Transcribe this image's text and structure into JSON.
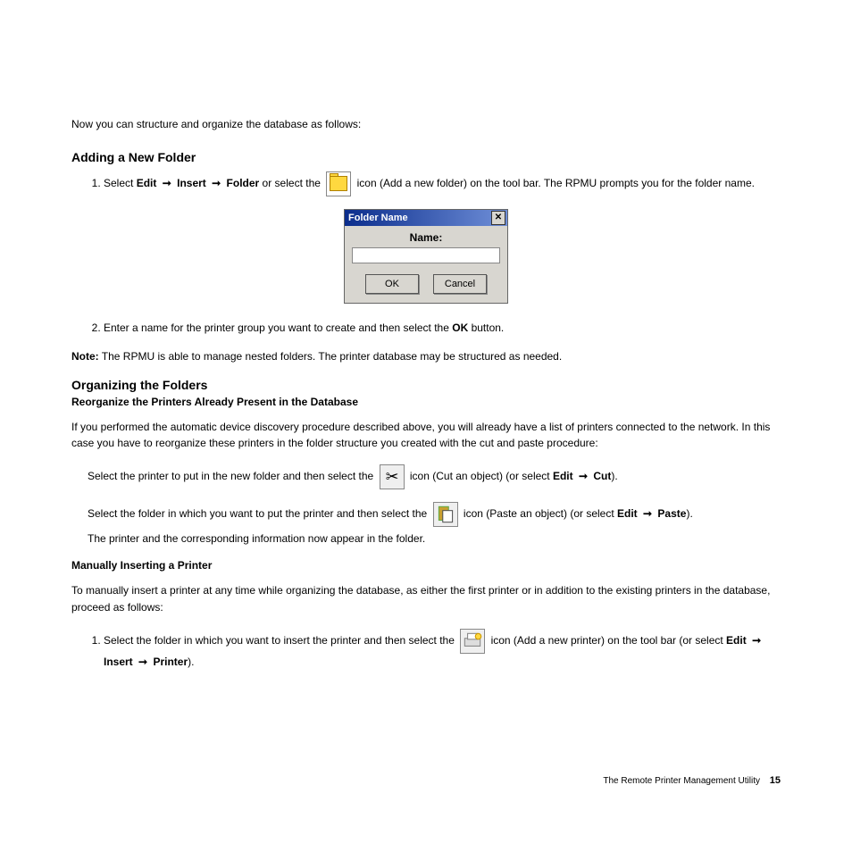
{
  "intro": "Now you can structure and organize the database as follows:",
  "section_add_folder": {
    "heading": "Adding a New Folder",
    "step1_a": "Select ",
    "step1_edit": "Edit",
    "step1_insert": "Insert",
    "step1_folder": "Folder",
    "step1_b": " or select the ",
    "step1_c": " icon (Add a new folder) on the tool bar. The RPMU prompts you for the folder name.",
    "step2_a": "Enter a name for the printer group you want to create and then select the ",
    "step2_ok": "OK",
    "step2_b": " button.",
    "note_label": "Note:",
    "note_text": "  The RPMU is able to manage nested folders. The printer database may be structured as needed."
  },
  "dialog": {
    "title": "Folder Name",
    "close": "✕",
    "label": "Name:",
    "value": "",
    "ok": "OK",
    "cancel": "Cancel"
  },
  "section_organize": {
    "heading": "Organizing the Folders",
    "sub": "Reorganize the Printers Already Present in the Database",
    "p1": "If you performed the automatic device discovery procedure described above, you will already have a list of printers connected to the network. In this case you have to reorganize these printers in the folder structure you created with the cut and paste procedure:",
    "cut_a": "Select the printer to put in the new folder and then select the ",
    "cut_b": " icon (Cut an object) (or select ",
    "cut_edit": "Edit",
    "cut_cmd": "Cut",
    "cut_c": ").",
    "paste_a": "Select the folder in which you want to put the printer and then select the ",
    "paste_b": " icon (Paste an object) (or select ",
    "paste_edit": "Edit",
    "paste_cmd": "Paste",
    "paste_c": ").",
    "p4": "The printer and the corresponding information now appear in the folder."
  },
  "section_manual": {
    "heading": "Manually Inserting a Printer",
    "p1": "To manually insert a printer at any time while organizing the database, as either the first printer or in addition to the existing printers in the database, proceed as follows:",
    "step1_a": "Select the folder in which you want to insert the printer and then select the ",
    "step1_b": " icon (Add a new printer) on the tool bar (or select ",
    "step1_edit": "Edit",
    "step1_insert": "Insert",
    "step1_printer": "Printer",
    "step1_c": ")."
  },
  "footer": {
    "text": "The Remote Printer Management Utility",
    "page": "15"
  },
  "arrow": "➞"
}
